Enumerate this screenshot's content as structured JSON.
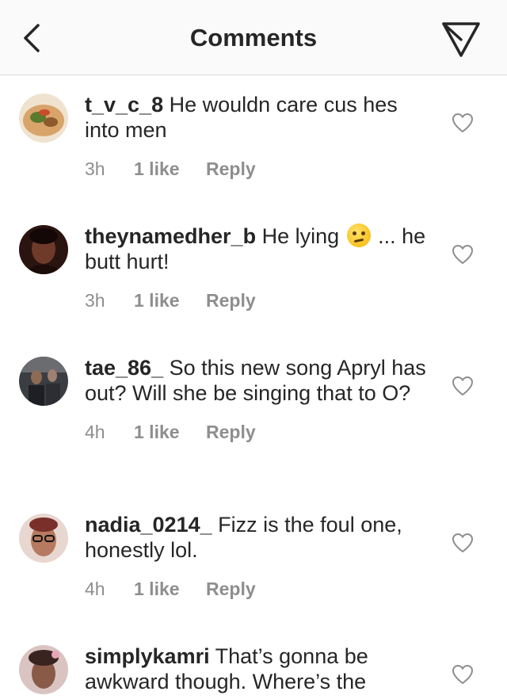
{
  "header": {
    "title": "Comments"
  },
  "comments": [
    {
      "username": "t_v_c_8",
      "text_before": " He wouldn care cus hes into men",
      "text_after": "",
      "time": "3h",
      "likes": "1 like",
      "reply": "Reply",
      "avatar_colors": [
        "#d8a46a",
        "#5a7a2e"
      ]
    },
    {
      "username": "theynamedher_b",
      "text_before": " He lying ",
      "text_after": " ... he butt hurt!",
      "emoji": "thinking-face",
      "time": "3h",
      "likes": "1 like",
      "reply": "Reply",
      "avatar_colors": [
        "#3a1b14",
        "#7a3a2a"
      ]
    },
    {
      "username": "tae_86_",
      "text_before": " So this new song Apryl has out? Will she be singing that to O?",
      "text_after": "",
      "time": "4h",
      "likes": "1 like",
      "reply": "Reply",
      "avatar_colors": [
        "#2b2d31",
        "#8d7c6a"
      ]
    },
    {
      "username": "nadia_0214_",
      "text_before": " Fizz is the foul one, honestly lol.",
      "text_after": "",
      "time": "4h",
      "likes": "1 like",
      "reply": "Reply",
      "avatar_colors": [
        "#c58b74",
        "#6b2f2a"
      ]
    },
    {
      "username": "simplykamri",
      "text_before": " That’s gonna be awkward though. Where’s the",
      "text_after": "",
      "time": "",
      "likes": "",
      "reply": "",
      "avatar_colors": [
        "#c9a5a0",
        "#4a2e28"
      ]
    }
  ],
  "colors": {
    "text": "#262626",
    "secondary": "#8e8e8e",
    "header_bg": "#fafafa",
    "divider": "#dbdbdb"
  }
}
